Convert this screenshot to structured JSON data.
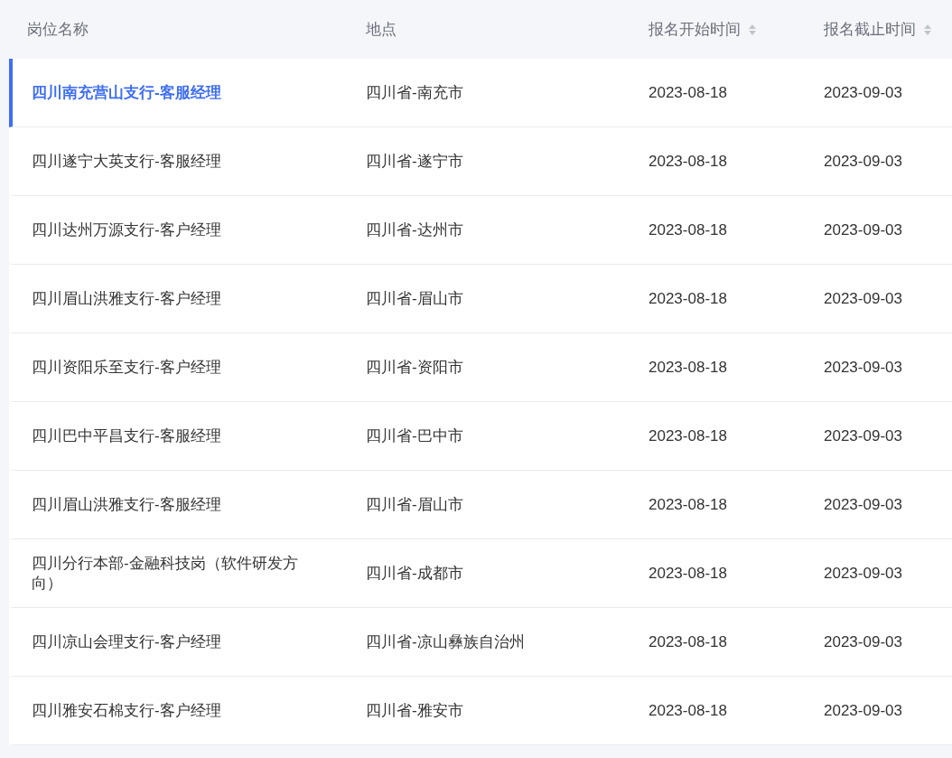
{
  "table": {
    "columns": [
      {
        "label": "岗位名称",
        "sortable": false
      },
      {
        "label": "地点",
        "sortable": false
      },
      {
        "label": "报名开始时间",
        "sortable": true
      },
      {
        "label": "报名截止时间",
        "sortable": true
      }
    ],
    "rows": [
      {
        "selected": true,
        "cells": [
          "四川南充营山支行-客服经理",
          "四川省-南充市",
          "2023-08-18",
          "2023-09-03"
        ]
      },
      {
        "selected": false,
        "cells": [
          "四川遂宁大英支行-客服经理",
          "四川省-遂宁市",
          "2023-08-18",
          "2023-09-03"
        ]
      },
      {
        "selected": false,
        "cells": [
          "四川达州万源支行-客户经理",
          "四川省-达州市",
          "2023-08-18",
          "2023-09-03"
        ]
      },
      {
        "selected": false,
        "cells": [
          "四川眉山洪雅支行-客户经理",
          "四川省-眉山市",
          "2023-08-18",
          "2023-09-03"
        ]
      },
      {
        "selected": false,
        "cells": [
          "四川资阳乐至支行-客户经理",
          "四川省-资阳市",
          "2023-08-18",
          "2023-09-03"
        ]
      },
      {
        "selected": false,
        "cells": [
          "四川巴中平昌支行-客服经理",
          "四川省-巴中市",
          "2023-08-18",
          "2023-09-03"
        ]
      },
      {
        "selected": false,
        "cells": [
          "四川眉山洪雅支行-客服经理",
          "四川省-眉山市",
          "2023-08-18",
          "2023-09-03"
        ]
      },
      {
        "selected": false,
        "cells": [
          "四川分行本部-金融科技岗（软件研发方向）",
          "四川省-成都市",
          "2023-08-18",
          "2023-09-03"
        ]
      },
      {
        "selected": false,
        "cells": [
          "四川凉山会理支行-客户经理",
          "四川省-凉山彝族自治州",
          "2023-08-18",
          "2023-09-03"
        ]
      },
      {
        "selected": false,
        "cells": [
          "四川雅安石棉支行-客户经理",
          "四川省-雅安市",
          "2023-08-18",
          "2023-09-03"
        ]
      }
    ]
  }
}
